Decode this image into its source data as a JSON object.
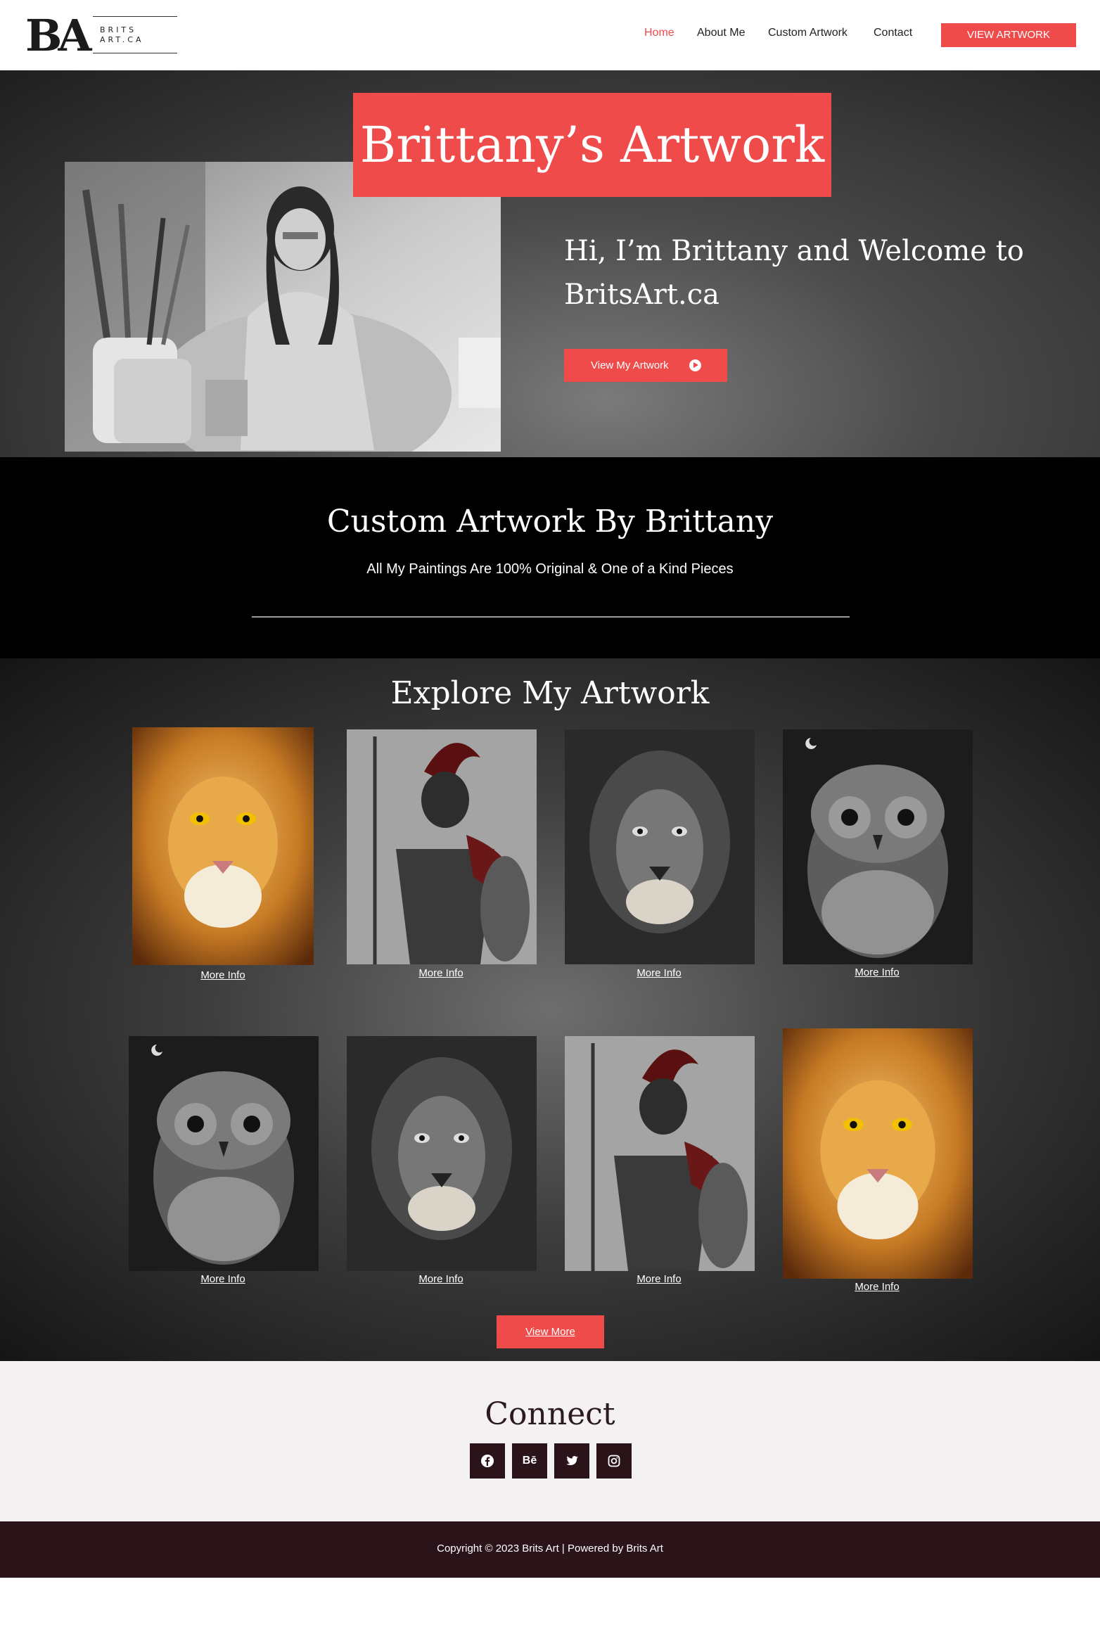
{
  "header": {
    "logo_main": "BA",
    "logo_sub_line1": "BRITS",
    "logo_sub_line2": "ART.CA",
    "nav": [
      {
        "label": "Home",
        "active": true
      },
      {
        "label": "About Me",
        "active": false
      },
      {
        "label": "Custom Artwork",
        "active": false
      },
      {
        "label": "Contact",
        "active": false
      }
    ],
    "cta_label": "VIEW ARTWORK"
  },
  "hero": {
    "title": "Brittany’s Artwork",
    "heading_line1": "Hi, I’m Brittany and Welcome to",
    "heading_line2": "BritsArt.ca",
    "button_label": "View My Artwork"
  },
  "custom": {
    "title": "Custom Artwork By Brittany",
    "subtitle": "All My Paintings Are 100% Original & One of a Kind Pieces"
  },
  "explore": {
    "title": "Explore My Artwork",
    "items": [
      {
        "subject": "lion-color",
        "link_label": "More Info"
      },
      {
        "subject": "spartan",
        "link_label": "More Info"
      },
      {
        "subject": "lion-bw",
        "link_label": "More Info"
      },
      {
        "subject": "owl",
        "link_label": "More Info"
      },
      {
        "subject": "owl",
        "link_label": "More Info"
      },
      {
        "subject": "lion-bw",
        "link_label": "More Info"
      },
      {
        "subject": "spartan",
        "link_label": "More Info"
      },
      {
        "subject": "lion-color",
        "link_label": "More Info"
      }
    ],
    "view_more_label": "View More"
  },
  "connect": {
    "title": "Connect",
    "social": [
      {
        "icon": "facebook-icon"
      },
      {
        "icon": "behance-icon",
        "label": "Bē"
      },
      {
        "icon": "twitter-icon"
      },
      {
        "icon": "instagram-icon"
      }
    ]
  },
  "footer": {
    "copyright": "Copyright © 2023 Brits Art | Powered by Brits Art"
  },
  "colors": {
    "accent": "#ef4b4b",
    "dark": "#2b1419",
    "connect_bg": "#f4f1f2"
  }
}
